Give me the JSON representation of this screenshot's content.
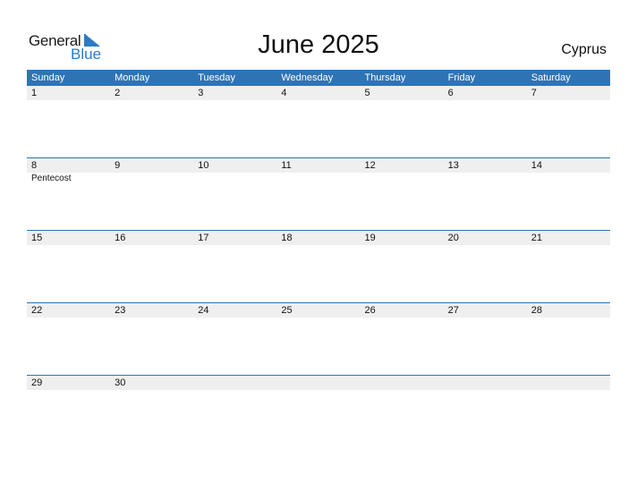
{
  "logo": {
    "line1": "General",
    "line2": "Blue"
  },
  "title": "June 2025",
  "country": "Cyprus",
  "colors": {
    "header_bg": "#2e74b5",
    "band_bg": "#efefef",
    "brand": "#2a7bc4"
  },
  "weekdays": [
    "Sunday",
    "Monday",
    "Tuesday",
    "Wednesday",
    "Thursday",
    "Friday",
    "Saturday"
  ],
  "weeks": [
    {
      "days": [
        "1",
        "2",
        "3",
        "4",
        "5",
        "6",
        "7"
      ],
      "events": [
        "",
        "",
        "",
        "",
        "",
        "",
        ""
      ]
    },
    {
      "days": [
        "8",
        "9",
        "10",
        "11",
        "12",
        "13",
        "14"
      ],
      "events": [
        "Pentecost",
        "",
        "",
        "",
        "",
        "",
        ""
      ]
    },
    {
      "days": [
        "15",
        "16",
        "17",
        "18",
        "19",
        "20",
        "21"
      ],
      "events": [
        "",
        "",
        "",
        "",
        "",
        "",
        ""
      ]
    },
    {
      "days": [
        "22",
        "23",
        "24",
        "25",
        "26",
        "27",
        "28"
      ],
      "events": [
        "",
        "",
        "",
        "",
        "",
        "",
        ""
      ]
    },
    {
      "days": [
        "29",
        "30",
        "",
        "",
        "",
        "",
        ""
      ],
      "events": [
        "",
        "",
        "",
        "",
        "",
        "",
        ""
      ]
    }
  ]
}
